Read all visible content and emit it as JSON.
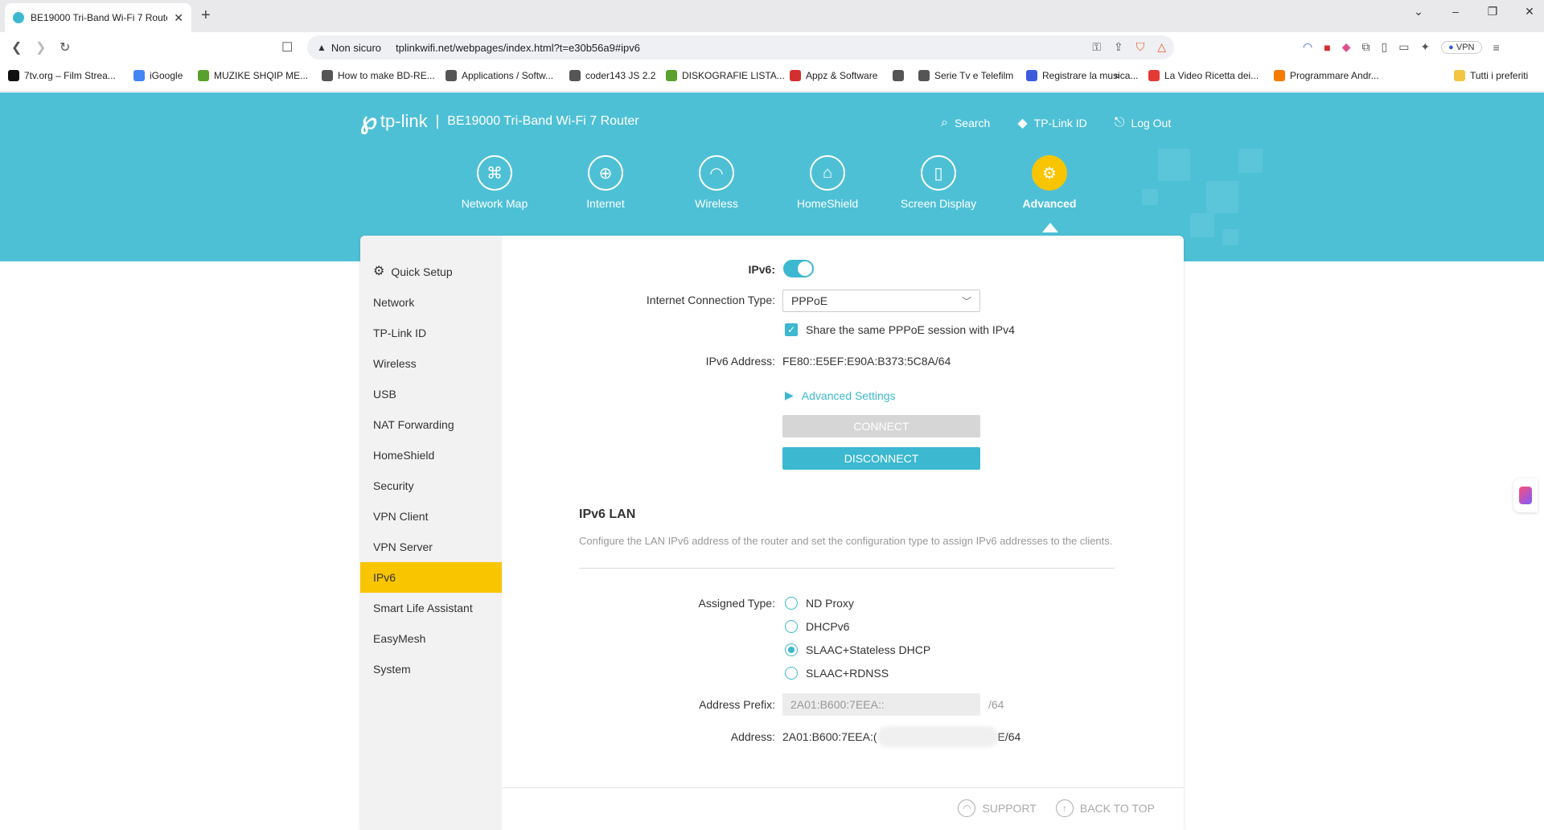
{
  "browser": {
    "tab_title": "BE19000 Tri-Band Wi-Fi 7 Route",
    "new_tab": "+",
    "not_secure": "Non sicuro",
    "url": "tplinkwifi.net/webpages/index.html?t=e30b56a9#ipv6",
    "vpn_label": "VPN",
    "bookmarks": [
      {
        "label": "7tv.org – Film Strea...",
        "color": "#111111"
      },
      {
        "label": "iGoogle",
        "color": "#4285f4"
      },
      {
        "label": "MUZIKE SHQIP ME...",
        "color": "#5aa02c"
      },
      {
        "label": "How to make BD-RE...",
        "color": "#555555"
      },
      {
        "label": "Applications / Softw...",
        "color": "#555555"
      },
      {
        "label": "coder143 JS 2.2",
        "color": "#555555"
      },
      {
        "label": "DISKOGRAFIE LISTA...",
        "color": "#5aa02c"
      },
      {
        "label": "Appz & Software",
        "color": "#d32f2f"
      },
      {
        "label": "",
        "color": "#555555"
      },
      {
        "label": "Serie Tv e Telefilm",
        "color": "#555555"
      },
      {
        "label": "Registrare la musica...",
        "color": "#3b5bdb"
      },
      {
        "label": "La Video Ricetta dei...",
        "color": "#e53935"
      },
      {
        "label": "Programmare Andr...",
        "color": "#f57c00"
      }
    ],
    "bookmarks_more": "»",
    "all_bookmarks": "Tutti i preferiti"
  },
  "router": {
    "brand": "tp-link",
    "model": "BE19000 Tri-Band Wi-Fi 7 Router",
    "top_links": {
      "search": "Search",
      "tplink_id": "TP-Link ID",
      "logout": "Log Out"
    },
    "nav": [
      {
        "label": "Network Map",
        "icon": "network-map-icon"
      },
      {
        "label": "Internet",
        "icon": "globe-icon"
      },
      {
        "label": "Wireless",
        "icon": "wifi-icon"
      },
      {
        "label": "HomeShield",
        "icon": "homeshield-icon"
      },
      {
        "label": "Screen Display",
        "icon": "screen-icon"
      },
      {
        "label": "Advanced",
        "icon": "gear-icon"
      }
    ],
    "active_nav": "Advanced",
    "sidebar": [
      "Quick Setup",
      "Network",
      "TP-Link ID",
      "Wireless",
      "USB",
      "NAT Forwarding",
      "HomeShield",
      "Security",
      "VPN Client",
      "VPN Server",
      "IPv6",
      "Smart Life Assistant",
      "EasyMesh",
      "System"
    ],
    "sidebar_active": "IPv6",
    "ipv6": {
      "toggle_label": "IPv6:",
      "enabled": true,
      "conn_type_label": "Internet Connection Type:",
      "conn_type_value": "PPPoE",
      "share_session_label": "Share the same PPPoE session with IPv4",
      "share_session_checked": true,
      "address_label": "IPv6 Address:",
      "address_value": "FE80::E5EF:E90A:B373:5C8A/64",
      "advanced_settings": "Advanced Settings",
      "connect_btn": "CONNECT",
      "disconnect_btn": "DISCONNECT"
    },
    "ipv6_lan": {
      "title": "IPv6 LAN",
      "description": "Configure the LAN IPv6 address of the router and set the configuration type to assign IPv6 addresses to the clients.",
      "assigned_type_label": "Assigned Type:",
      "options": [
        "ND Proxy",
        "DHCPv6",
        "SLAAC+Stateless DHCP",
        "SLAAC+RDNSS"
      ],
      "selected": "SLAAC+Stateless DHCP",
      "prefix_label": "Address Prefix:",
      "prefix_value": "2A01:B600:7EEA::",
      "prefix_suffix": "/64",
      "address_label": "Address:",
      "address_start": "2A01:B600:7EEA:(",
      "address_end": "E/64"
    },
    "footer": {
      "support": "SUPPORT",
      "back_to_top": "BACK TO TOP"
    },
    "colors": {
      "accent": "#3cb8d0",
      "active": "#f8c500",
      "hero": "#4ec0d6"
    }
  }
}
